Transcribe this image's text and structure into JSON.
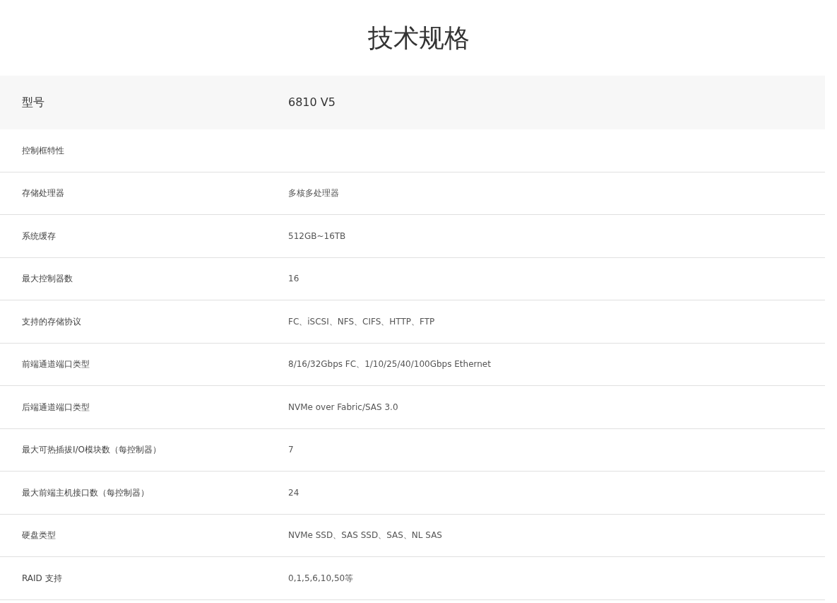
{
  "title": "技术规格",
  "header": {
    "label": "型号",
    "value": "6810 V5"
  },
  "rows": [
    {
      "label": "控制框特性",
      "value": null
    },
    {
      "label": "存储处理器",
      "value": "多核多处理器"
    },
    {
      "label": "系统缓存",
      "value": "512GB~16TB"
    },
    {
      "label": "最大控制器数",
      "value": "16"
    },
    {
      "label": "支持的存储协议",
      "value": "FC、iSCSI、NFS、CIFS、HTTP、FTP"
    },
    {
      "label": "前端通道端口类型",
      "value": "8/16/32Gbps FC、1/10/25/40/100Gbps Ethernet"
    },
    {
      "label": "后端通道端口类型",
      "value": "NVMe over Fabric/SAS 3.0"
    },
    {
      "label": "最大可热插拔I/O模块数（每控制器）",
      "value": "7"
    },
    {
      "label": "最大前端主机接口数（每控制器）",
      "value": "24"
    },
    {
      "label": "硬盘类型",
      "value": "NVMe SSD、SAS SSD、SAS、NL SAS"
    },
    {
      "label": "RAID 支持",
      "value": "0,1,5,6,10,50等"
    }
  ]
}
